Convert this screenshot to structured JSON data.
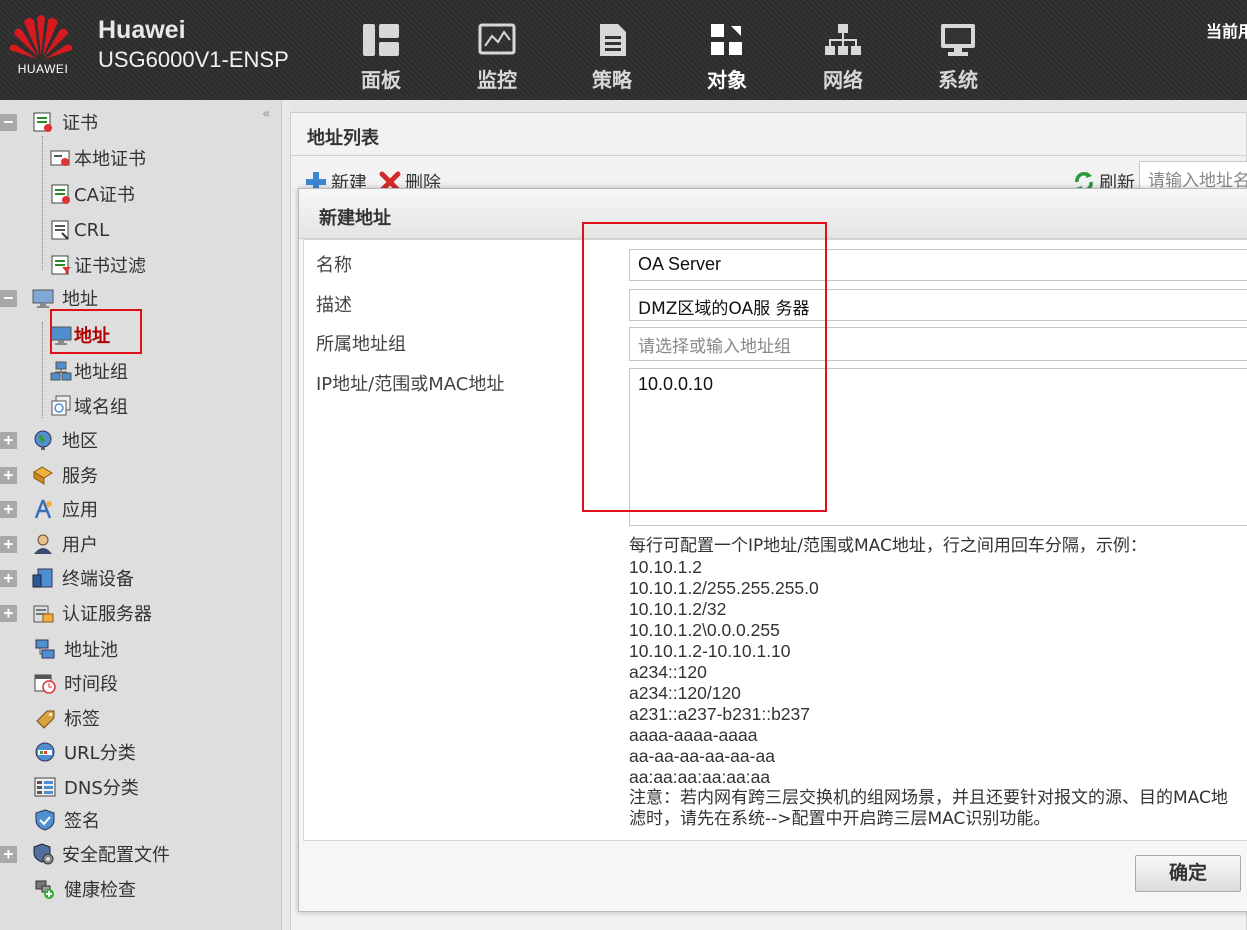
{
  "header": {
    "brand_name": "Huawei",
    "brand_model": "USG6000V1-ENSP",
    "logo_text": "HUAWEI",
    "current_user_label": "当前用",
    "nav": [
      {
        "label": "面板",
        "icon": "dashboard-icon"
      },
      {
        "label": "监控",
        "icon": "monitor-icon"
      },
      {
        "label": "策略",
        "icon": "policy-icon"
      },
      {
        "label": "对象",
        "icon": "object-icon",
        "active": true
      },
      {
        "label": "网络",
        "icon": "network-icon"
      },
      {
        "label": "系统",
        "icon": "system-icon"
      }
    ]
  },
  "sidebar": {
    "collapse_glyph": "«",
    "items": [
      {
        "label": "证书",
        "toggle": "−",
        "icon": "certificate-icon"
      },
      {
        "label": "本地证书",
        "icon": "local-certificate-icon"
      },
      {
        "label": "CA证书",
        "icon": "ca-certificate-icon"
      },
      {
        "label": "CRL",
        "icon": "crl-icon"
      },
      {
        "label": "证书过滤",
        "icon": "certificate-filter-icon"
      },
      {
        "label": "地址",
        "toggle": "−",
        "icon": "address-icon"
      },
      {
        "label": "地址",
        "icon": "address-object-icon",
        "selected": true
      },
      {
        "label": "地址组",
        "icon": "address-group-icon"
      },
      {
        "label": "域名组",
        "icon": "domain-group-icon"
      },
      {
        "label": "地区",
        "toggle": "+",
        "icon": "region-icon"
      },
      {
        "label": "服务",
        "toggle": "+",
        "icon": "service-icon"
      },
      {
        "label": "应用",
        "toggle": "+",
        "icon": "application-icon"
      },
      {
        "label": "用户",
        "toggle": "+",
        "icon": "user-icon"
      },
      {
        "label": "终端设备",
        "toggle": "+",
        "icon": "terminal-device-icon"
      },
      {
        "label": "认证服务器",
        "toggle": "+",
        "icon": "auth-server-icon"
      },
      {
        "label": "地址池",
        "icon": "address-pool-icon"
      },
      {
        "label": "时间段",
        "icon": "time-range-icon"
      },
      {
        "label": "标签",
        "icon": "tag-icon"
      },
      {
        "label": "URL分类",
        "icon": "url-category-icon"
      },
      {
        "label": "DNS分类",
        "icon": "dns-category-icon"
      },
      {
        "label": "签名",
        "icon": "signature-icon"
      },
      {
        "label": "安全配置文件",
        "toggle": "+",
        "icon": "security-profile-icon"
      },
      {
        "label": "健康检查",
        "icon": "health-check-icon"
      }
    ]
  },
  "main": {
    "panel_title": "地址列表",
    "toolbar": {
      "new_label": "新建",
      "delete_label": "删除",
      "refresh_label": "刷新",
      "search_placeholder": "请输入地址名"
    }
  },
  "dialog": {
    "title": "新建地址",
    "fields": {
      "name_label": "名称",
      "name_value": "OA Server",
      "desc_label": "描述",
      "desc_value": "DMZ区域的OA服 务器",
      "group_label": "所属地址组",
      "group_placeholder": "请选择或输入地址组",
      "ip_label": "IP地址/范围或MAC地址",
      "ip_value": "10.0.0.10"
    },
    "help_intro": "每行可配置一个IP地址/范围或MAC地址，行之间用回车分隔，示例：",
    "help_examples": [
      "10.10.1.2",
      "10.10.1.2/255.255.255.0",
      "10.10.1.2/32",
      "10.10.1.2\\0.0.0.255",
      "10.10.1.2-10.10.1.10",
      "a234::120",
      "a234::120/120",
      "a231::a237-b231::b237",
      "aaaa-aaaa-aaaa",
      "aa-aa-aa-aa-aa-aa",
      "aa:aa:aa:aa:aa:aa"
    ],
    "help_note_line1": "注意：若内网有跨三层交换机的组网场景，并且还要针对报文的源、目的MAC地",
    "help_note_line2": "滤时，请先在系统-->配置中开启跨三层MAC识别功能。",
    "ok_label": "确定"
  },
  "colors": {
    "header_bg": "#2e2e2e",
    "highlight_red": "#e0101a",
    "logo_red": "#d71920"
  }
}
